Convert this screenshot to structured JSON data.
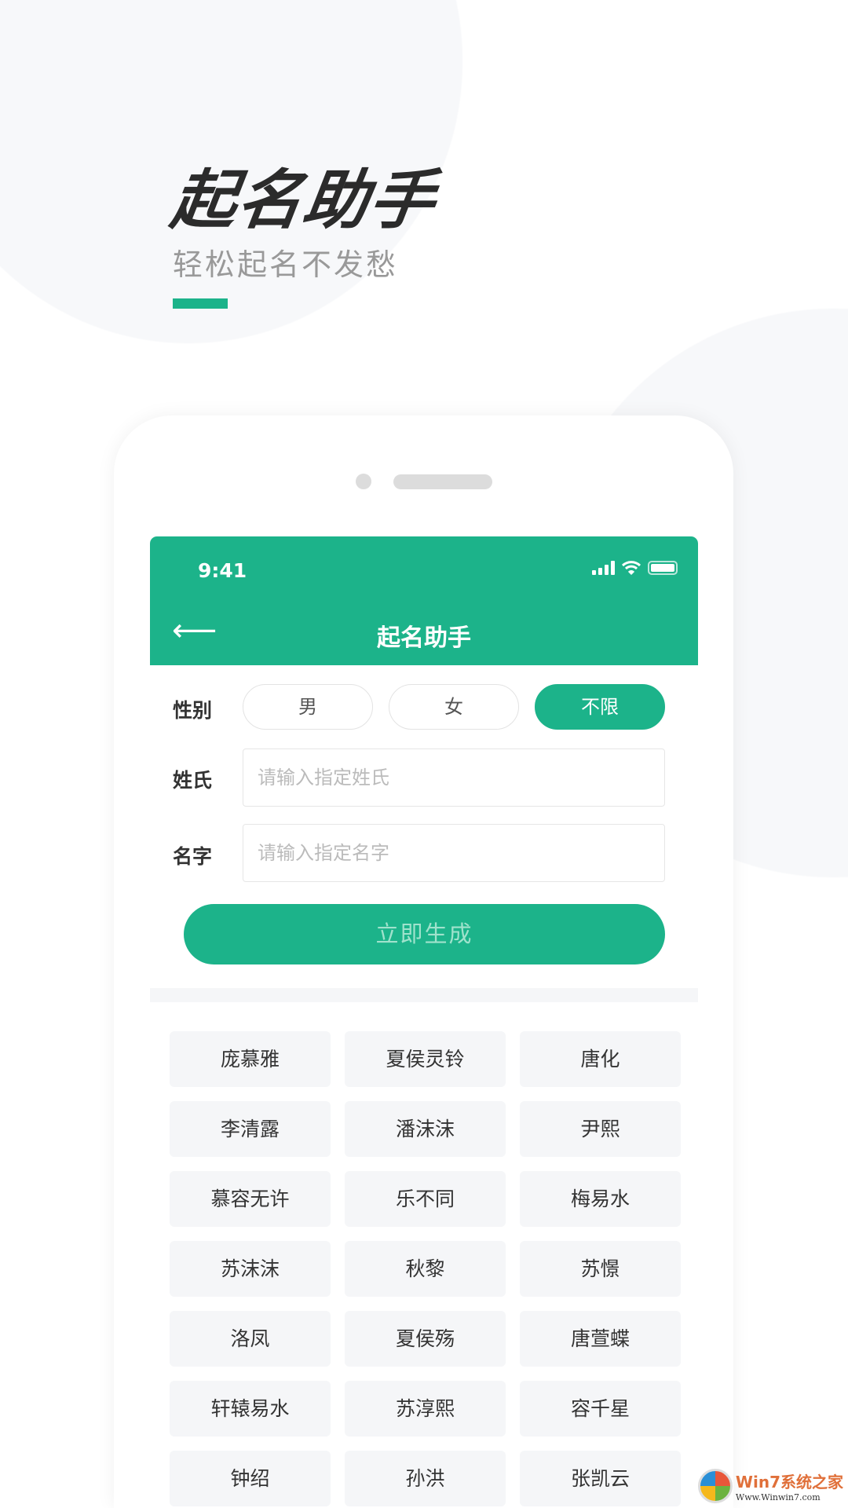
{
  "hero": {
    "title": "起名助手",
    "subtitle": "轻松起名不发愁",
    "accent_color": "#1cb38a"
  },
  "status_bar": {
    "time": "9:41",
    "icons": [
      "signal-icon",
      "wifi-icon",
      "battery-icon"
    ]
  },
  "nav": {
    "back_icon": "arrow-left-icon",
    "title": "起名助手"
  },
  "form": {
    "gender_label": "性别",
    "gender_options": [
      {
        "label": "男",
        "selected": false
      },
      {
        "label": "女",
        "selected": false
      },
      {
        "label": "不限",
        "selected": true
      }
    ],
    "surname_label": "姓氏",
    "surname_value": "",
    "surname_placeholder": "请输入指定姓氏",
    "name_label": "名字",
    "name_value": "",
    "name_placeholder": "请输入指定名字",
    "generate_label": "立即生成"
  },
  "results": [
    "庞慕雅",
    "夏侯灵铃",
    "唐化",
    "李清露",
    "潘沫沫",
    "尹熙",
    "慕容无许",
    "乐不同",
    "梅易水",
    "苏沫沫",
    "秋黎",
    "苏憬",
    "洛凤",
    "夏侯殇",
    "唐萱蝶",
    "轩辕易水",
    "苏淳熙",
    "容千星",
    "钟绍",
    "孙洪",
    "张凯云"
  ],
  "watermark": {
    "brand": "Win7系统之家",
    "url": "Www.Winwin7.com"
  }
}
